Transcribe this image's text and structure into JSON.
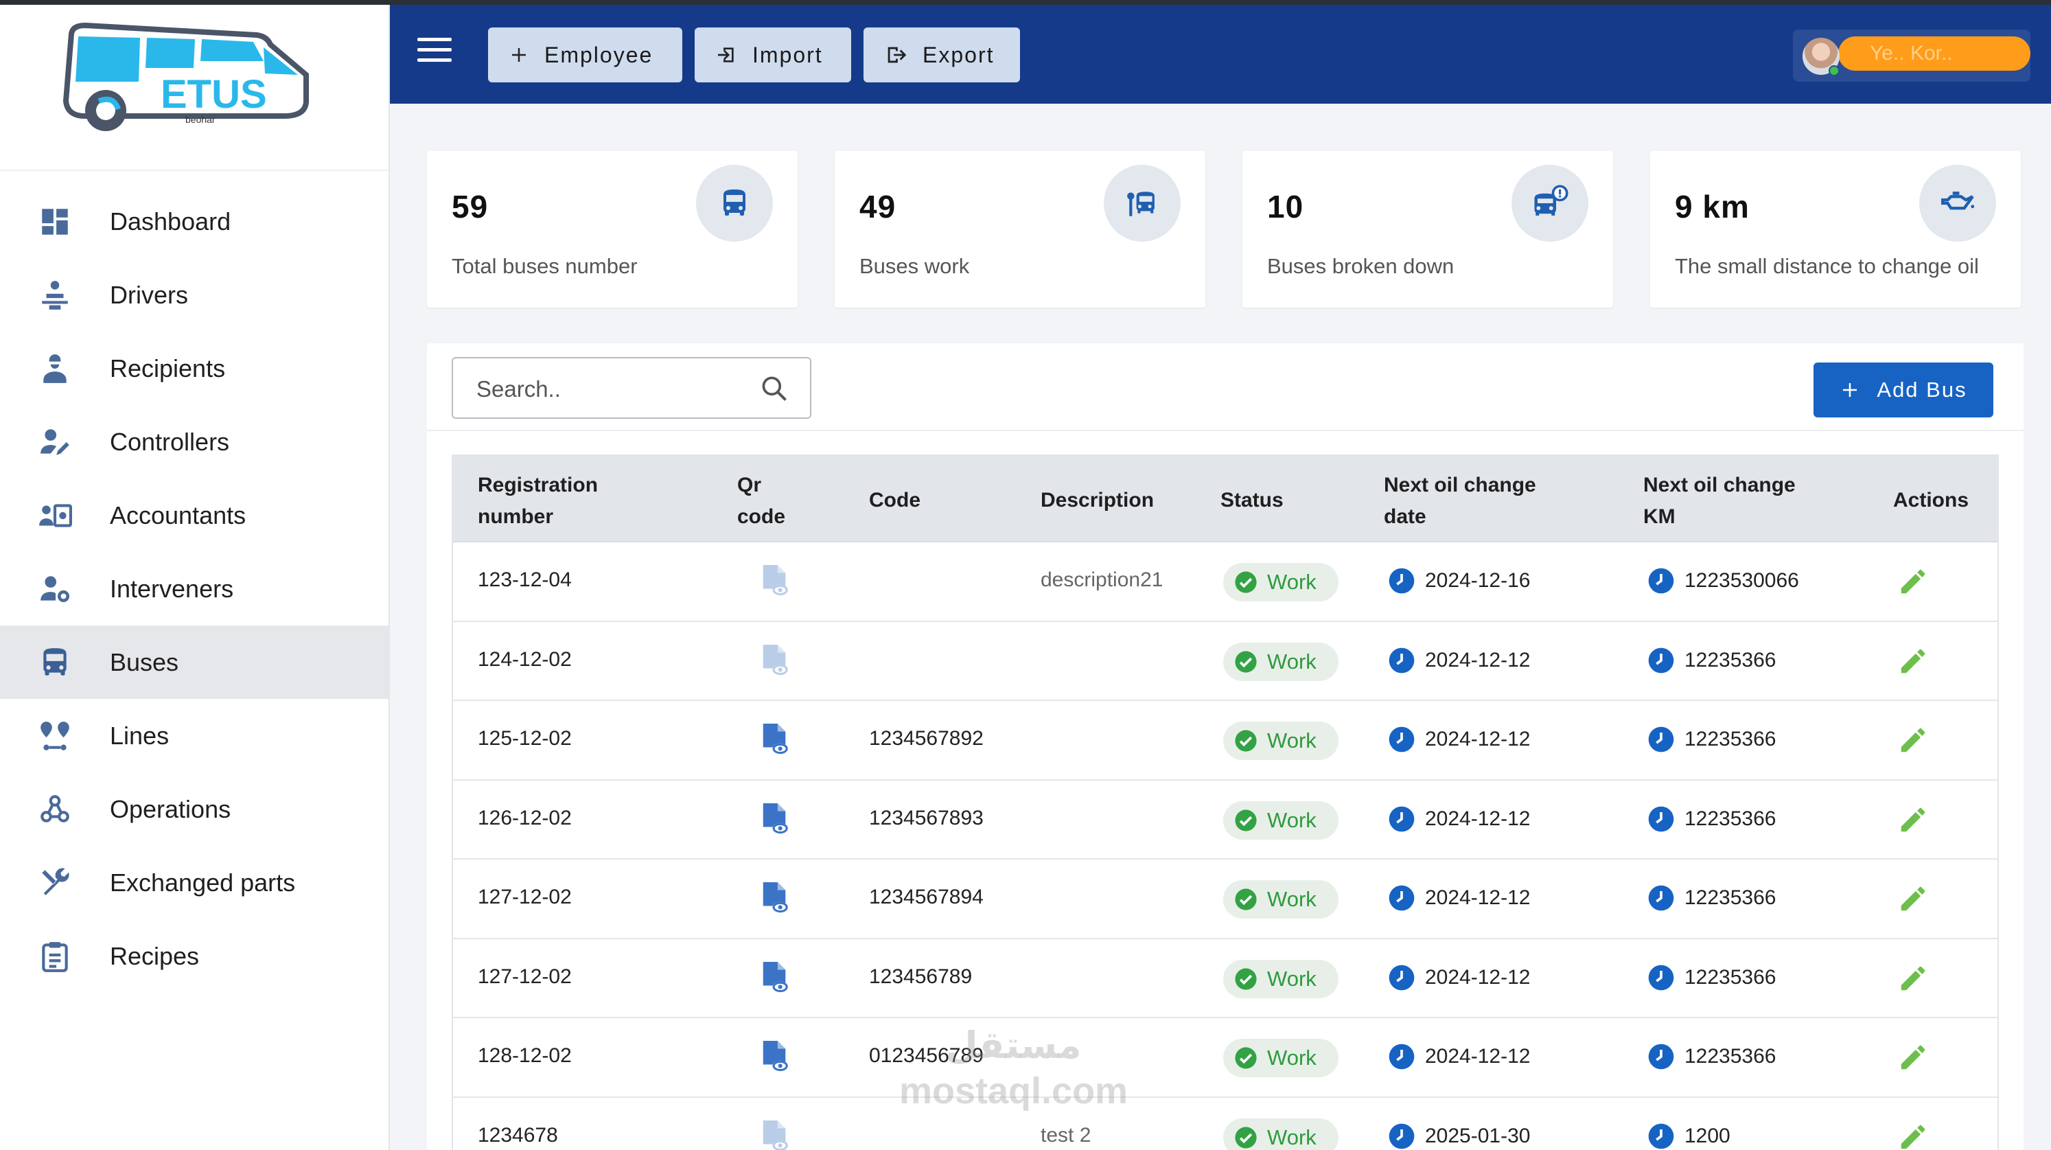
{
  "brand": {
    "logo_text": "ETUS",
    "logo_subtext": "beohar"
  },
  "sidebar": {
    "items": [
      {
        "label": "Dashboard",
        "icon": "dashboard-icon"
      },
      {
        "label": "Drivers",
        "icon": "driver-icon"
      },
      {
        "label": "Recipients",
        "icon": "worker-icon"
      },
      {
        "label": "Controllers",
        "icon": "user-edit-icon"
      },
      {
        "label": "Accountants",
        "icon": "accountant-icon"
      },
      {
        "label": "Interveners",
        "icon": "user-gear-icon"
      },
      {
        "label": "Buses",
        "icon": "bus-icon",
        "active": true
      },
      {
        "label": "Lines",
        "icon": "route-icon"
      },
      {
        "label": "Operations",
        "icon": "hub-icon"
      },
      {
        "label": "Exchanged parts",
        "icon": "tools-icon"
      },
      {
        "label": "Recipes",
        "icon": "clipboard-icon"
      }
    ]
  },
  "header": {
    "employee_label": "Employee",
    "import_label": "Import",
    "export_label": "Export",
    "user_name": "Ye.. Kor.."
  },
  "stats": [
    {
      "value": "59",
      "label": "Total buses number",
      "icon": "bus-icon"
    },
    {
      "value": "49",
      "label": "Buses work",
      "icon": "bus-stop-icon"
    },
    {
      "value": "10",
      "label": "Buses broken down",
      "icon": "bus-alert-icon"
    },
    {
      "value": "9 km",
      "label": "The small distance to change oil",
      "icon": "oil-can-icon"
    }
  ],
  "search": {
    "placeholder": "Search.."
  },
  "add_bus_label": "Add Bus",
  "table": {
    "headers": {
      "registration": [
        "Registration",
        "number"
      ],
      "qr": [
        "Qr",
        "code"
      ],
      "code": "Code",
      "description": "Description",
      "status": "Status",
      "next_oil_date": [
        "Next oil change",
        "date"
      ],
      "next_oil_km": [
        "Next oil change",
        "KM"
      ],
      "actions": "Actions"
    },
    "rows": [
      {
        "registration": "123-12-04",
        "qr": "faded",
        "code": "",
        "description": "description21",
        "status": "Work",
        "next_oil_date": "2024-12-16",
        "next_oil_km": "1223530066"
      },
      {
        "registration": "124-12-02",
        "qr": "faded",
        "code": "",
        "description": "",
        "status": "Work",
        "next_oil_date": "2024-12-12",
        "next_oil_km": "12235366"
      },
      {
        "registration": "125-12-02",
        "qr": "active",
        "code": "1234567892",
        "description": "",
        "status": "Work",
        "next_oil_date": "2024-12-12",
        "next_oil_km": "12235366"
      },
      {
        "registration": "126-12-02",
        "qr": "active",
        "code": "1234567893",
        "description": "",
        "status": "Work",
        "next_oil_date": "2024-12-12",
        "next_oil_km": "12235366"
      },
      {
        "registration": "127-12-02",
        "qr": "active",
        "code": "1234567894",
        "description": "",
        "status": "Work",
        "next_oil_date": "2024-12-12",
        "next_oil_km": "12235366"
      },
      {
        "registration": "127-12-02",
        "qr": "active",
        "code": "123456789",
        "description": "",
        "status": "Work",
        "next_oil_date": "2024-12-12",
        "next_oil_km": "12235366"
      },
      {
        "registration": "128-12-02",
        "qr": "active",
        "code": "0123456789",
        "description": "",
        "status": "Work",
        "next_oil_date": "2024-12-12",
        "next_oil_km": "12235366"
      },
      {
        "registration": "1234678",
        "qr": "faded",
        "code": "",
        "description": "test 2",
        "status": "Work",
        "next_oil_date": "2025-01-30",
        "next_oil_km": "1200"
      }
    ]
  },
  "watermark": {
    "arabic": "مستقل",
    "latin": "mostaql.com"
  },
  "colors": {
    "header_bg": "#153a8a",
    "primary": "#1763c4",
    "status_green": "#2e9a3e",
    "edit_green": "#6cbf4a"
  }
}
